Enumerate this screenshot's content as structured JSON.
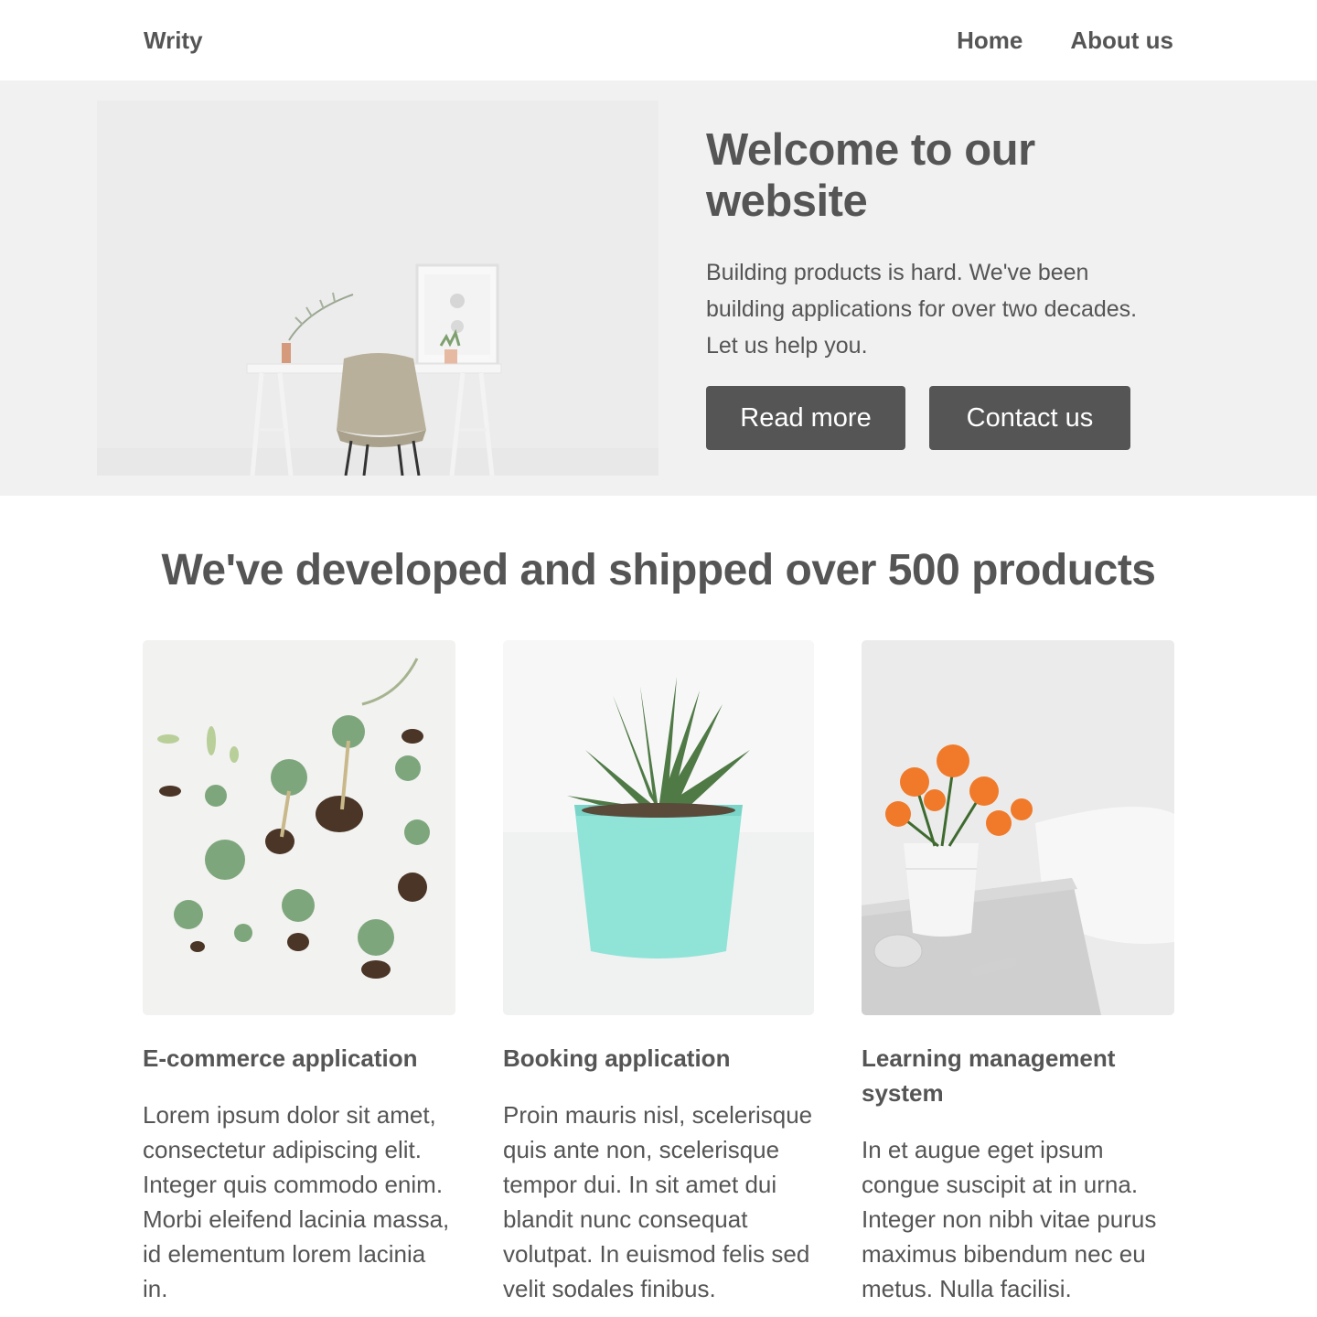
{
  "nav": {
    "brand": "Writy",
    "links": [
      {
        "label": "Home"
      },
      {
        "label": "About us"
      }
    ]
  },
  "hero": {
    "title": "Welcome to our website",
    "description": "Building products is hard. We've been building applications for over two decades. Let us help you.",
    "buttons": {
      "read_more": "Read more",
      "contact": "Contact us"
    }
  },
  "products": {
    "heading": "We've developed and shipped over 500 products",
    "cards": [
      {
        "title": "E-commerce application",
        "text": "Lorem ipsum dolor sit amet, consectetur adipiscing elit. Integer quis commodo enim. Morbi eleifend lacinia massa, id elementum lorem lacinia in."
      },
      {
        "title": "Booking application",
        "text": "Proin mauris nisl, scelerisque quis ante non, scelerisque tempor dui. In sit amet dui blandit nunc consequat volutpat. In euismod felis sed velit sodales finibus."
      },
      {
        "title": "Learning management system",
        "text": "In et augue eget ipsum congue suscipit at in urna. Integer non nibh vitae purus maximus bibendum nec eu metus. Nulla facilisi."
      }
    ]
  },
  "colors": {
    "text": "#555555",
    "hero_bg": "#f1f1f1",
    "button_bg": "#555555",
    "button_text": "#ffffff"
  }
}
